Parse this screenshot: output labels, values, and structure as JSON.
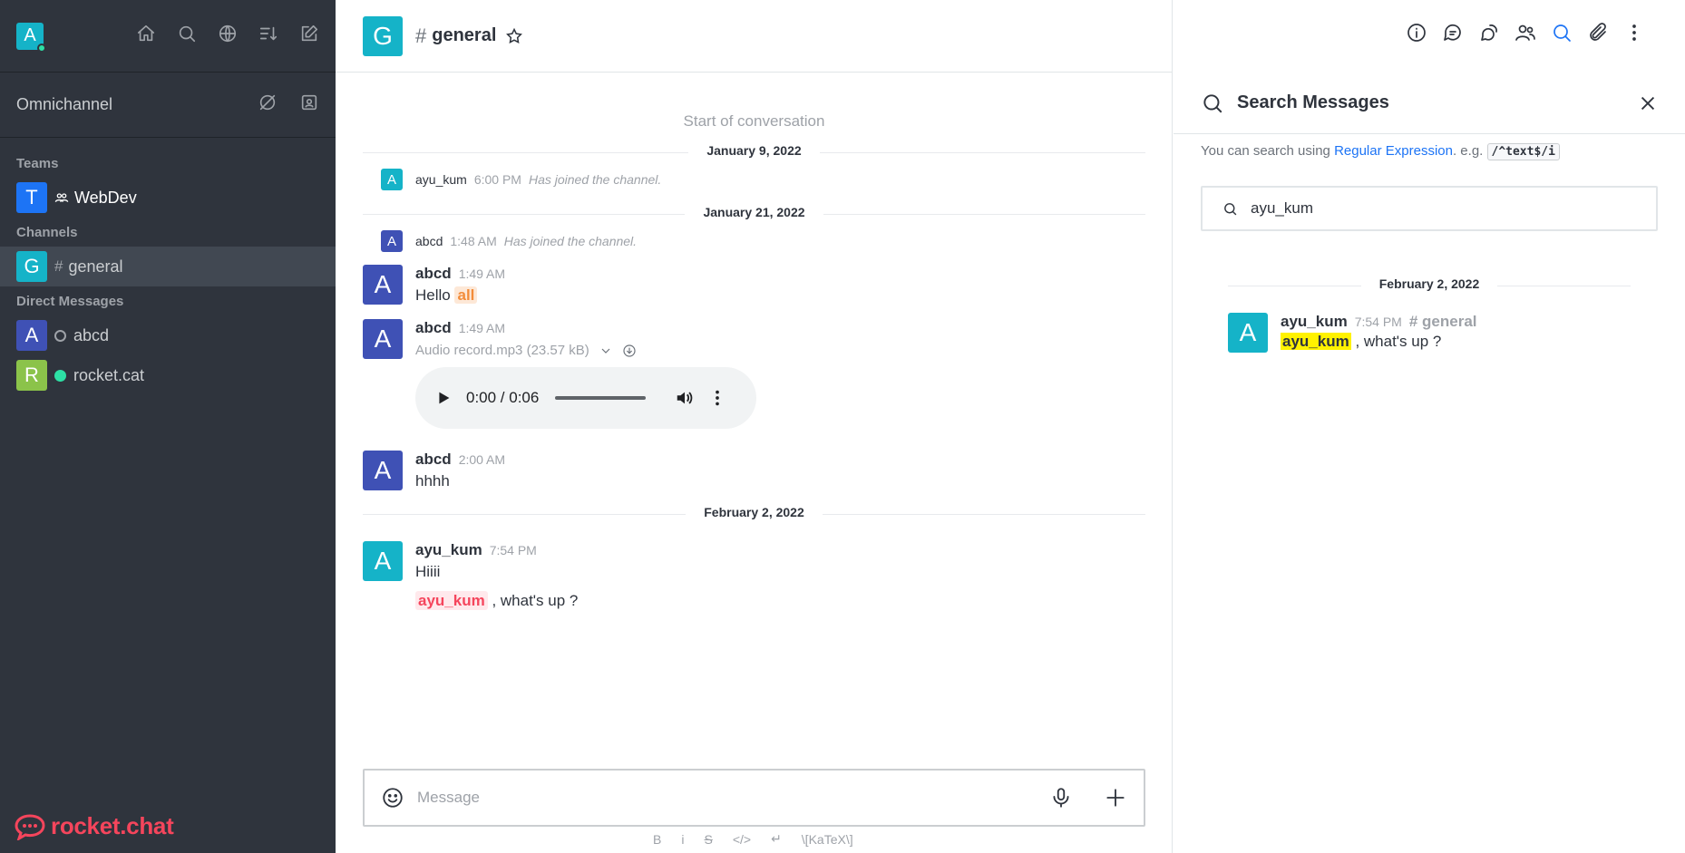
{
  "sidebar": {
    "user_initial": "A",
    "omnichannel_label": "Omnichannel",
    "teams_label": "Teams",
    "channels_label": "Channels",
    "dm_label": "Direct Messages",
    "teams": [
      {
        "initial": "T",
        "name": "WebDev",
        "color": "#1d74f5"
      }
    ],
    "channels": [
      {
        "initial": "G",
        "name": "general",
        "color": "#15b3c8"
      }
    ],
    "dms": [
      {
        "initial": "A",
        "name": "abcd",
        "color": "#3f51b5",
        "status": "offline"
      },
      {
        "initial": "R",
        "name": "rocket.cat",
        "color": "#8bc34a",
        "status": "online"
      }
    ],
    "brand": "rocket.chat"
  },
  "room": {
    "initial": "G",
    "name": "general"
  },
  "messages": {
    "start": "Start of conversation",
    "day1": "January 9, 2022",
    "sys1": {
      "initial": "A",
      "user": "ayu_kum",
      "time": "6:00 PM",
      "text": "Has joined the channel."
    },
    "day2": "January 21, 2022",
    "sys2": {
      "initial": "A",
      "user": "abcd",
      "time": "1:48 AM",
      "text": "Has joined the channel."
    },
    "m1": {
      "initial": "A",
      "user": "abcd",
      "time": "1:49 AM",
      "text": "Hello",
      "mention": "all"
    },
    "m2": {
      "initial": "A",
      "user": "abcd",
      "time": "1:49 AM",
      "file": "Audio record.mp3",
      "size": "(23.57 kB)",
      "audio_time": "0:00 / 0:06"
    },
    "m3": {
      "initial": "A",
      "user": "abcd",
      "time": "2:00 AM",
      "text": "hhhh"
    },
    "day3": "February 2, 2022",
    "m4": {
      "initial": "A",
      "user": "ayu_kum",
      "time": "7:54 PM",
      "text": "Hiiii",
      "mention": "ayu_kum",
      "text2": ", what's up ?"
    }
  },
  "composer": {
    "placeholder": "Message",
    "formats": [
      "B",
      "i",
      "S",
      "</>",
      "↵",
      "\\[KaTeX\\]"
    ]
  },
  "search_panel": {
    "title": "Search Messages",
    "hint_prefix": "You can search using",
    "hint_link": "Regular Expression",
    "hint_suffix": ". e.g.",
    "hint_code": "/^text$/i",
    "query": "ayu_kum",
    "date": "February 2, 2022",
    "result": {
      "initial": "A",
      "user": "ayu_kum",
      "time": "7:54 PM",
      "channel": "general",
      "highlight": "ayu_kum",
      "text": ", what's up ?"
    }
  }
}
